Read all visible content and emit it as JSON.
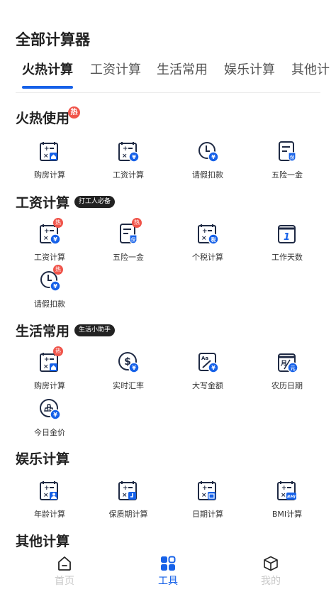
{
  "page_title": "全部计算器",
  "tabs": [
    {
      "label": "火热计算"
    },
    {
      "label": "工资计算"
    },
    {
      "label": "生活常用"
    },
    {
      "label": "娱乐计算"
    },
    {
      "label": "其他计"
    }
  ],
  "sections": [
    {
      "title": "火热使用",
      "badge": "热",
      "tools": [
        {
          "label": "购房计算",
          "icon": "house-calculator-icon"
        },
        {
          "label": "工资计算",
          "icon": "yuan-calculator-icon"
        },
        {
          "label": "请假扣款",
          "icon": "clock-yuan-icon"
        },
        {
          "label": "五险一金",
          "icon": "insurance-doc-icon",
          "sub": "保"
        }
      ]
    },
    {
      "title": "工资计算",
      "badge": "打工人必备",
      "tools": [
        {
          "label": "工资计算",
          "icon": "yuan-calculator-icon",
          "hot": "热"
        },
        {
          "label": "五险一金",
          "icon": "insurance-doc-icon",
          "hot": "热",
          "sub": "保"
        },
        {
          "label": "个税计算",
          "icon": "tax-calculator-icon",
          "sub": "税"
        },
        {
          "label": "工作天数",
          "icon": "calendar-one-icon",
          "num": "1"
        },
        {
          "label": "请假扣款",
          "icon": "clock-yuan-icon",
          "hot": "热"
        }
      ]
    },
    {
      "title": "生活常用",
      "badge": "生活小助手",
      "tools": [
        {
          "label": "购房计算",
          "icon": "house-calculator-icon",
          "hot": "热"
        },
        {
          "label": "实时汇率",
          "icon": "exchange-rate-icon",
          "sym": "$"
        },
        {
          "label": "大写金额",
          "icon": "uppercase-amount-icon",
          "sym": "Aa"
        },
        {
          "label": "农历日期",
          "icon": "lunar-calendar-icon",
          "sym": "月",
          "sub": "元"
        },
        {
          "label": "今日金价",
          "icon": "gold-price-icon"
        }
      ]
    },
    {
      "title": "娱乐计算",
      "badge": "",
      "tools": [
        {
          "label": "年龄计算",
          "icon": "age-calculator-icon"
        },
        {
          "label": "保质期计算",
          "icon": "shelf-life-calculator-icon"
        },
        {
          "label": "日期计算",
          "icon": "date-calculator-icon"
        },
        {
          "label": "BMI计算",
          "icon": "bmi-calculator-icon",
          "sub": "BMI"
        }
      ]
    },
    {
      "title": "其他计算",
      "badge": "",
      "tools": []
    }
  ],
  "bottom_nav": [
    {
      "label": "首页",
      "icon": "home-icon",
      "active": false
    },
    {
      "label": "工具",
      "icon": "tools-grid-icon",
      "active": true
    },
    {
      "label": "我的",
      "icon": "cube-icon",
      "active": false
    }
  ],
  "colors": {
    "accent": "#1661e8",
    "icon_dark": "#1f2a44",
    "hot": "#f0544a",
    "nav_inactive": "#c8c8c8"
  }
}
